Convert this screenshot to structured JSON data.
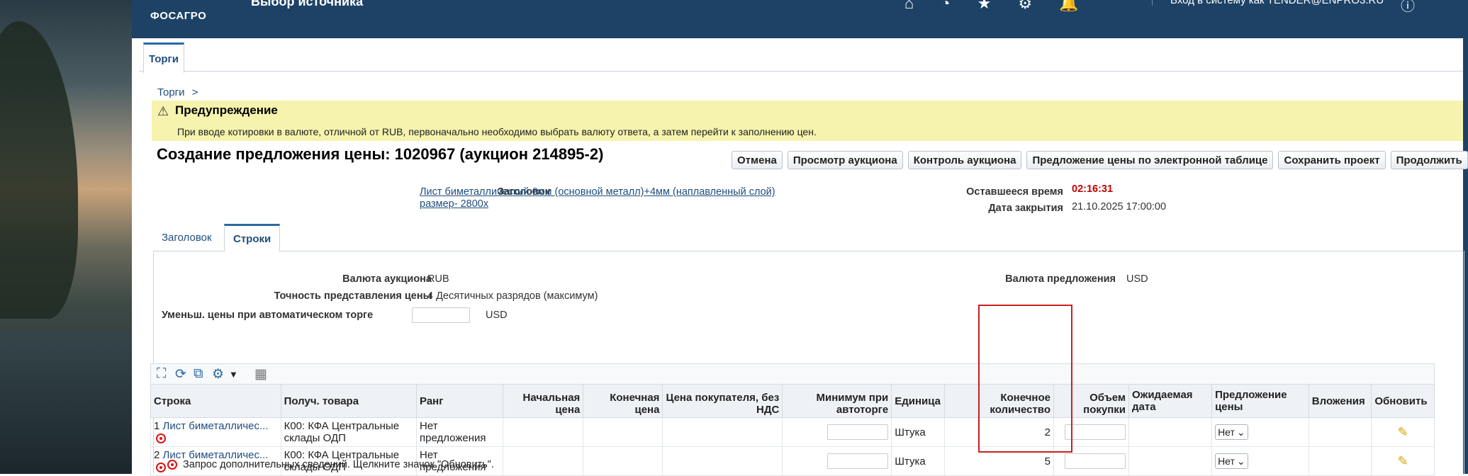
{
  "header": {
    "logo": "ФОСАГРО",
    "title": "Выбор источника",
    "login_text": "Вход в систему как TENDER@ENPRO3.RU",
    "icons": [
      "home-icon",
      "history-icon",
      "favorites-icon",
      "settings-icon",
      "notifications-icon",
      "help-icon"
    ],
    "bg_color": "#1d4266"
  },
  "main_tab": {
    "label": "Торги"
  },
  "breadcrumb": {
    "label": "Торги",
    "sep": ">"
  },
  "warning": {
    "title": "Предупреждение",
    "message": "При вводе котировки в валюте, отличной от RUB, первоначально необходимо выбрать валюту ответа, а затем перейти к заполнению цен."
  },
  "page_title": "Создание предложения цены: 1020967 (аукцион 214895-2)",
  "buttons": {
    "cancel": "Отмена",
    "view_auction": "Просмотр аукциона",
    "monitor_auction": "Контроль аукциона",
    "spreadsheet": "Предложение цены по электронной таблице",
    "save_draft": "Сохранить проект",
    "continue": "Продолжить"
  },
  "summary": {
    "header_label": "Заголовок",
    "header_value_line1": "Лист биметаллический 6мм (основной металл)+4мм (наплавленный слой)",
    "header_value_line2": "размер- 2800х",
    "remaining_label": "Оставшееся время",
    "remaining_value": "02:16:31",
    "close_label": "Дата закрытия",
    "close_value": "21.10.2025 17:00:00"
  },
  "subtabs": {
    "header": "Заголовок",
    "lines": "Строки"
  },
  "lines_panel": {
    "auction_currency_label": "Валюта аукциона",
    "auction_currency_value": "RUB",
    "precision_label": "Точность представления цены",
    "precision_value": "4 Десятичных разрядов (максимум)",
    "bid_currency_label": "Валюта предложения",
    "bid_currency_value": "USD",
    "auto_decrement_label": "Уменьш. цены при автоматическом торге",
    "auto_decrement_currency": "USD"
  },
  "table": {
    "headers": {
      "line": "Строка",
      "ship_to": "Получ. товара",
      "rank": "Ранг",
      "start_price": "Начальная цена",
      "target_price": "Конечная цена",
      "buyer_price": "Цена покупателя, без НДС",
      "min_auto": "Минимум при автоторге",
      "unit": "Единица",
      "target_qty": "Конечное количество",
      "bid_qty": "Объем покупки",
      "promised_date": "Ожидаемая дата",
      "bid_price": "Предложение цены",
      "attachments": "Вложения",
      "update": "Обновить"
    },
    "rows": [
      {
        "num": "1",
        "item": "Лист биметалличес...",
        "ship_to": "К00: КФА Центральные склады ОДП",
        "rank": "Нет предложения",
        "unit": "Штука",
        "qty": "2",
        "bid_price": "Нет"
      },
      {
        "num": "2",
        "item": "Лист биметалличес...",
        "ship_to": "К00: КФА Центральные склады ОДП",
        "rank": "Нет предложения",
        "unit": "Штука",
        "qty": "5",
        "bid_price": "Нет"
      }
    ]
  },
  "footer_note": "Запрос дополнительных сведений. Щелкните значок \"Обновить\".",
  "colors": {
    "link": "#1f4d7e",
    "accent": "#2b69a3",
    "warning_bg": "#f5f3ad",
    "timer": "#c30000",
    "highlight_box": "#c9201e"
  }
}
